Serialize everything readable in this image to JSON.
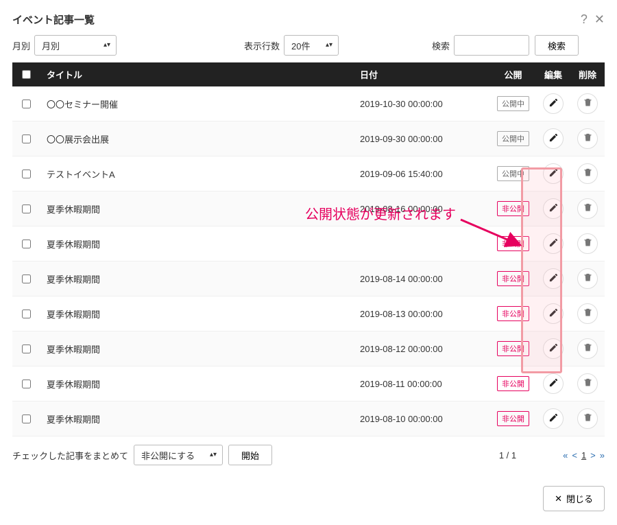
{
  "dialog": {
    "title": "イベント記事一覧",
    "close_label": "閉じる"
  },
  "filters": {
    "month_label": "月別",
    "month_value": "月別",
    "rows_label": "表示行数",
    "rows_value": "20件",
    "search_label": "検索",
    "search_value": "",
    "search_button": "検索"
  },
  "columns": {
    "title": "タイトル",
    "date": "日付",
    "publish": "公開",
    "edit": "編集",
    "delete": "削除"
  },
  "status_labels": {
    "published": "公開中",
    "unpublished": "非公開"
  },
  "rows": [
    {
      "title": "〇〇セミナー開催",
      "date": "2019-10-30 00:00:00",
      "status": "published"
    },
    {
      "title": "〇〇展示会出展",
      "date": "2019-09-30 00:00:00",
      "status": "published"
    },
    {
      "title": "テストイベントA",
      "date": "2019-09-06 15:40:00",
      "status": "published"
    },
    {
      "title": "夏季休暇期間",
      "date": "2019-08-16 00:00:00",
      "status": "unpublished"
    },
    {
      "title": "夏季休暇期間",
      "date": "",
      "status": "unpublished"
    },
    {
      "title": "夏季休暇期間",
      "date": "2019-08-14 00:00:00",
      "status": "unpublished"
    },
    {
      "title": "夏季休暇期間",
      "date": "2019-08-13 00:00:00",
      "status": "unpublished"
    },
    {
      "title": "夏季休暇期間",
      "date": "2019-08-12 00:00:00",
      "status": "unpublished"
    },
    {
      "title": "夏季休暇期間",
      "date": "2019-08-11 00:00:00",
      "status": "unpublished"
    },
    {
      "title": "夏季休暇期間",
      "date": "2019-08-10 00:00:00",
      "status": "unpublished"
    }
  ],
  "bulk": {
    "label": "チェックした記事をまとめて",
    "action_value": "非公開にする",
    "start_button": "開始"
  },
  "pagination": {
    "info": "1 / 1",
    "first": "«",
    "prev": "<",
    "current": "1",
    "next": ">",
    "last": "»"
  },
  "annotation": {
    "text": "公開状態が更新されます"
  }
}
